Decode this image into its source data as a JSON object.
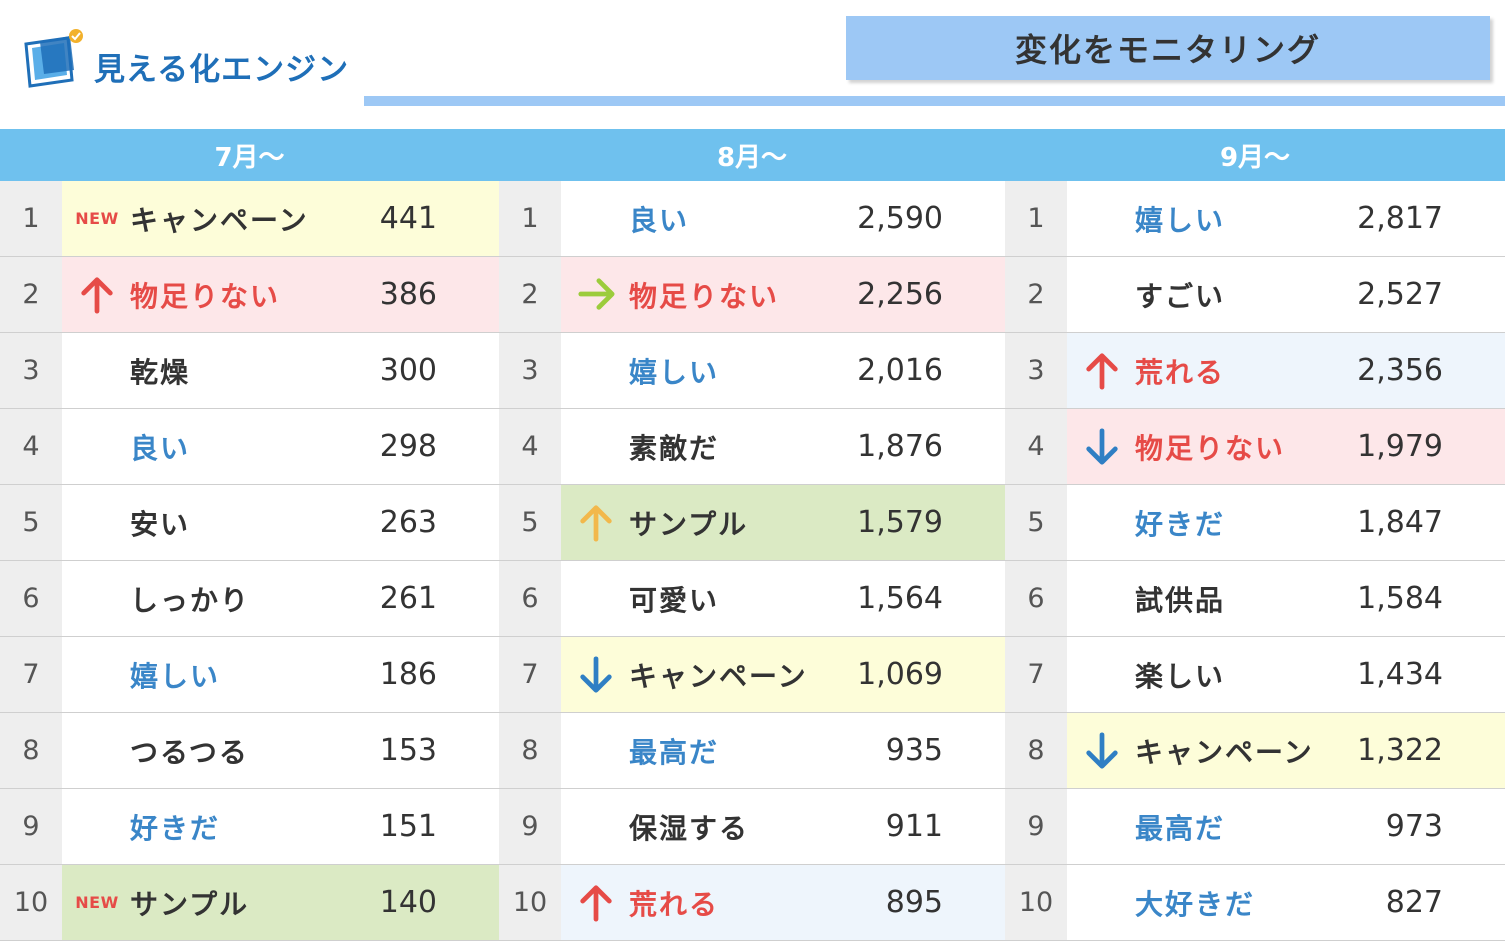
{
  "header": {
    "logo_text": "見える化エンジン",
    "title": "変化をモニタリング"
  },
  "colors": {
    "yellow": "#fdfdd9",
    "pink": "#fde7e9",
    "green": "#dbeac4",
    "lightblue": "#eef5fc",
    "white": "#ffffff",
    "blue_text": "#3a86c8",
    "red_text": "#e64b47",
    "black_text": "#333333"
  },
  "columns": [
    {
      "label": "7月〜",
      "rows": [
        {
          "rank": "1",
          "marker": "new",
          "word": "キャンペーン",
          "count": "441",
          "bg": "yellow",
          "color": "black"
        },
        {
          "rank": "2",
          "marker": "up-red",
          "word": "物足りない",
          "count": "386",
          "bg": "pink",
          "color": "red"
        },
        {
          "rank": "3",
          "marker": "",
          "word": "乾燥",
          "count": "300",
          "bg": "white",
          "color": "black"
        },
        {
          "rank": "4",
          "marker": "",
          "word": "良い",
          "count": "298",
          "bg": "white",
          "color": "blue"
        },
        {
          "rank": "5",
          "marker": "",
          "word": "安い",
          "count": "263",
          "bg": "white",
          "color": "black"
        },
        {
          "rank": "6",
          "marker": "",
          "word": "しっかり",
          "count": "261",
          "bg": "white",
          "color": "black"
        },
        {
          "rank": "7",
          "marker": "",
          "word": "嬉しい",
          "count": "186",
          "bg": "white",
          "color": "blue"
        },
        {
          "rank": "8",
          "marker": "",
          "word": "つるつる",
          "count": "153",
          "bg": "white",
          "color": "black"
        },
        {
          "rank": "9",
          "marker": "",
          "word": "好きだ",
          "count": "151",
          "bg": "white",
          "color": "blue"
        },
        {
          "rank": "10",
          "marker": "new",
          "word": "サンプル",
          "count": "140",
          "bg": "green",
          "color": "black"
        }
      ]
    },
    {
      "label": "8月〜",
      "rows": [
        {
          "rank": "1",
          "marker": "",
          "word": "良い",
          "count": "2,590",
          "bg": "white",
          "color": "blue"
        },
        {
          "rank": "2",
          "marker": "right-green",
          "word": "物足りない",
          "count": "2,256",
          "bg": "pink",
          "color": "red"
        },
        {
          "rank": "3",
          "marker": "",
          "word": "嬉しい",
          "count": "2,016",
          "bg": "white",
          "color": "blue"
        },
        {
          "rank": "4",
          "marker": "",
          "word": "素敵だ",
          "count": "1,876",
          "bg": "white",
          "color": "black"
        },
        {
          "rank": "5",
          "marker": "up-yellow",
          "word": "サンプル",
          "count": "1,579",
          "bg": "green",
          "color": "black"
        },
        {
          "rank": "6",
          "marker": "",
          "word": "可愛い",
          "count": "1,564",
          "bg": "white",
          "color": "black"
        },
        {
          "rank": "7",
          "marker": "down-blue",
          "word": "キャンペーン",
          "count": "1,069",
          "bg": "yellow",
          "color": "black"
        },
        {
          "rank": "8",
          "marker": "",
          "word": "最高だ",
          "count": "935",
          "bg": "white",
          "color": "blue"
        },
        {
          "rank": "9",
          "marker": "",
          "word": "保湿する",
          "count": "911",
          "bg": "white",
          "color": "black"
        },
        {
          "rank": "10",
          "marker": "up-red",
          "word": "荒れる",
          "count": "895",
          "bg": "lightblue",
          "color": "red"
        }
      ]
    },
    {
      "label": "9月〜",
      "rows": [
        {
          "rank": "1",
          "marker": "",
          "word": "嬉しい",
          "count": "2,817",
          "bg": "white",
          "color": "blue"
        },
        {
          "rank": "2",
          "marker": "",
          "word": "すごい",
          "count": "2,527",
          "bg": "white",
          "color": "black"
        },
        {
          "rank": "3",
          "marker": "up-red",
          "word": "荒れる",
          "count": "2,356",
          "bg": "lightblue",
          "color": "red"
        },
        {
          "rank": "4",
          "marker": "down-blue",
          "word": "物足りない",
          "count": "1,979",
          "bg": "pink",
          "color": "red"
        },
        {
          "rank": "5",
          "marker": "",
          "word": "好きだ",
          "count": "1,847",
          "bg": "white",
          "color": "blue"
        },
        {
          "rank": "6",
          "marker": "",
          "word": "試供品",
          "count": "1,584",
          "bg": "white",
          "color": "black"
        },
        {
          "rank": "7",
          "marker": "",
          "word": "楽しい",
          "count": "1,434",
          "bg": "white",
          "color": "black"
        },
        {
          "rank": "8",
          "marker": "down-blue",
          "word": "キャンペーン",
          "count": "1,322",
          "bg": "yellow",
          "color": "black"
        },
        {
          "rank": "9",
          "marker": "",
          "word": "最高だ",
          "count": "973",
          "bg": "white",
          "color": "blue"
        },
        {
          "rank": "10",
          "marker": "",
          "word": "大好きだ",
          "count": "827",
          "bg": "white",
          "color": "blue"
        }
      ]
    }
  ],
  "new_label": "NEW"
}
